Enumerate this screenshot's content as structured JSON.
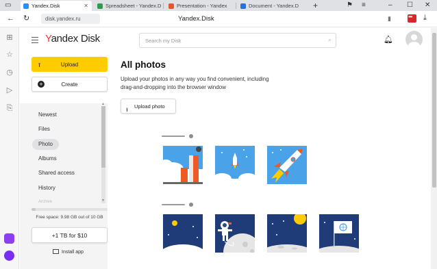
{
  "browser": {
    "tabs": [
      {
        "label": "Yandex.Disk",
        "active": true,
        "favicon_color": "#2b8ef5"
      },
      {
        "label": "Spreadsheet - Yandex.D",
        "active": false,
        "favicon_color": "#2e9c4b"
      },
      {
        "label": "Presentation - Yandex",
        "active": false,
        "favicon_color": "#e3572c"
      },
      {
        "label": "Document - Yandex.D",
        "active": false,
        "favicon_color": "#2b6fd8"
      }
    ],
    "url": "disk.yandex.ru",
    "page_title": "Yandex.Disk"
  },
  "header": {
    "logo_y": "Y",
    "logo_rest": "andex Disk",
    "search_placeholder": "Search my Disk"
  },
  "sidebar": {
    "upload_label": "Upload",
    "create_label": "Create",
    "nav": [
      {
        "label": "Newest",
        "active": false
      },
      {
        "label": "Files",
        "active": false
      },
      {
        "label": "Photo",
        "active": true
      },
      {
        "label": "Albums",
        "active": false
      },
      {
        "label": "Shared access",
        "active": false
      },
      {
        "label": "History",
        "active": false
      },
      {
        "label": "Archive",
        "active": false
      }
    ],
    "quota_used_fraction": 0.05,
    "free_space": "Free space: 9.98 GB out of 10 GB",
    "upgrade_label": "+1 TB for $10",
    "install_label": "Install app"
  },
  "main": {
    "title": "All photos",
    "description": "Upload your photos in any way you find convenient, including drag-and-dropping into the browser window",
    "upload_photo_label": "Upload photo"
  },
  "colors": {
    "accent": "#ffcc00",
    "logo_red": "#ff3333",
    "illustration_blue": "#4aa3e8",
    "illustration_navy": "#1f3b78",
    "rocket_orange": "#ee5a24"
  }
}
